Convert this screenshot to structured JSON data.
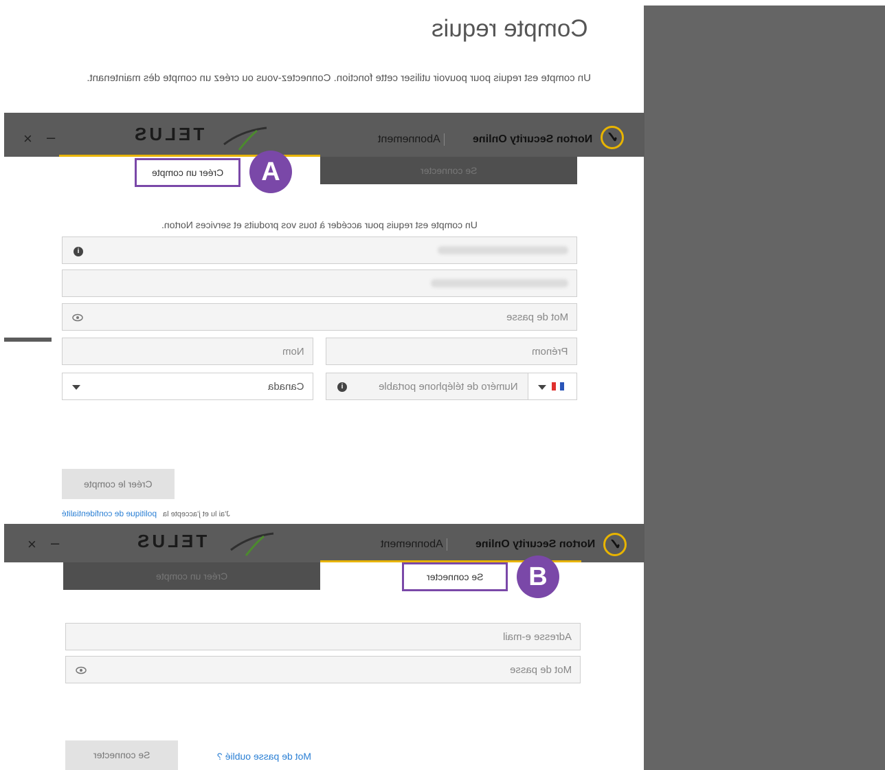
{
  "page": {
    "title": "Compte requis",
    "description": "Un compte est requis pour pouvoir utiliser cette fonction. Connectez-vous ou créez un compte dès maintenant."
  },
  "header": {
    "brand": "Norton Security Online",
    "subscription": "Abonnement",
    "partner_logo": "TELUS",
    "minimize_glyph": "–",
    "close_glyph": "×",
    "check_glyph": "✓"
  },
  "create_panel": {
    "callout": "A",
    "tab_create": "Créer un compte",
    "tab_signin": "Se connecter",
    "subtitle": "Un compte est requis pour accéder à tous vos produits et services Norton.",
    "password_placeholder": "Mot de passe",
    "first_name_placeholder": "Prénom",
    "last_name_placeholder": "Nom",
    "phone_placeholder": "Numéro de téléphone portable",
    "country_value": "Canada",
    "submit_label": "Créer le compte",
    "consent_prefix": "J'ai lu et j'accepte la",
    "privacy_link": "politique de confidentialité"
  },
  "signin_panel": {
    "callout": "B",
    "tab_signin": "Se connecter",
    "tab_create": "Créer un compte",
    "email_placeholder": "Adresse e-mail",
    "password_placeholder": "Mot de passe",
    "submit_label": "Se connecter",
    "forgot_link": "Mot de passe oublié ?"
  },
  "colors": {
    "accent_yellow": "#e8b400",
    "callout_purple": "#7a48a8",
    "header_gray": "#5b5b5b",
    "link_blue": "#2a7fd4"
  },
  "icons": {
    "info": "info-icon",
    "eye": "eye-icon",
    "dropdown": "chevron-down-icon",
    "flag": "france-flag-icon"
  }
}
